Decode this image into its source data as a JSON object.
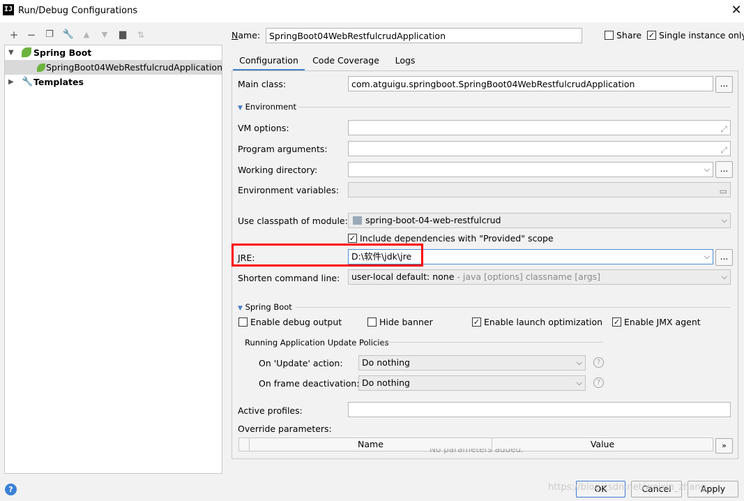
{
  "window": {
    "title": "Run/Debug Configurations",
    "app_icon_letter": "IJ"
  },
  "toolbar": {
    "icons": [
      "plus-icon",
      "minus-icon",
      "copy-icon",
      "wrench-icon",
      "arrow-up-icon",
      "arrow-down-icon",
      "folder-icon",
      "sort-icon"
    ]
  },
  "tree": {
    "spring_boot": "Spring Boot",
    "app": "SpringBoot04WebRestfulcrudApplication",
    "templates": "Templates"
  },
  "header": {
    "name_label": "Name:",
    "name_value": "SpringBoot04WebRestfulcrudApplication",
    "share": "Share",
    "single_instance": "Single instance only"
  },
  "tabs": [
    "Configuration",
    "Code Coverage",
    "Logs"
  ],
  "config": {
    "main_class_label": "Main class:",
    "main_class_value": "com.atguigu.springboot.SpringBoot04WebRestfulcrudApplication",
    "environment": "Environment",
    "vm_options": "VM options:",
    "program_arguments": "Program arguments:",
    "working_directory": "Working directory:",
    "environment_variables": "Environment variables:",
    "classpath_label": "Use classpath of module:",
    "classpath_value": "spring-boot-04-web-restfulcrud",
    "include_deps": "Include dependencies with \"Provided\" scope",
    "jre_label": "JRE:",
    "jre_value": "D:\\软件\\jdk\\jre",
    "shorten_label": "Shorten command line:",
    "shorten_value": "user-local default: none",
    "shorten_hint": " - java [options] classname [args]",
    "dots": "..."
  },
  "spring_boot": {
    "section": "Spring Boot",
    "enable_debug": "Enable debug output",
    "hide_banner": "Hide banner",
    "launch_opt": "Enable launch optimization",
    "jmx": "Enable JMX agent",
    "policies": "Running Application Update Policies",
    "on_update_label": "On 'Update' action:",
    "on_update_value": "Do nothing",
    "on_frame_label": "On frame deactivation:",
    "on_frame_value": "Do nothing",
    "active_profiles": "Active profiles:",
    "override_params": "Override parameters:",
    "col_name": "Name",
    "col_value": "Value",
    "no_params": "No parameters added."
  },
  "footer": {
    "ok": "OK",
    "cancel": "Cancel",
    "apply": "Apply",
    "help": "?",
    "watermark": "https://blog.csdn.net/weixin_zhang"
  },
  "colors": {
    "accent": "#4083c9",
    "highlight": "#ff0000",
    "spring": "#6db33f"
  }
}
